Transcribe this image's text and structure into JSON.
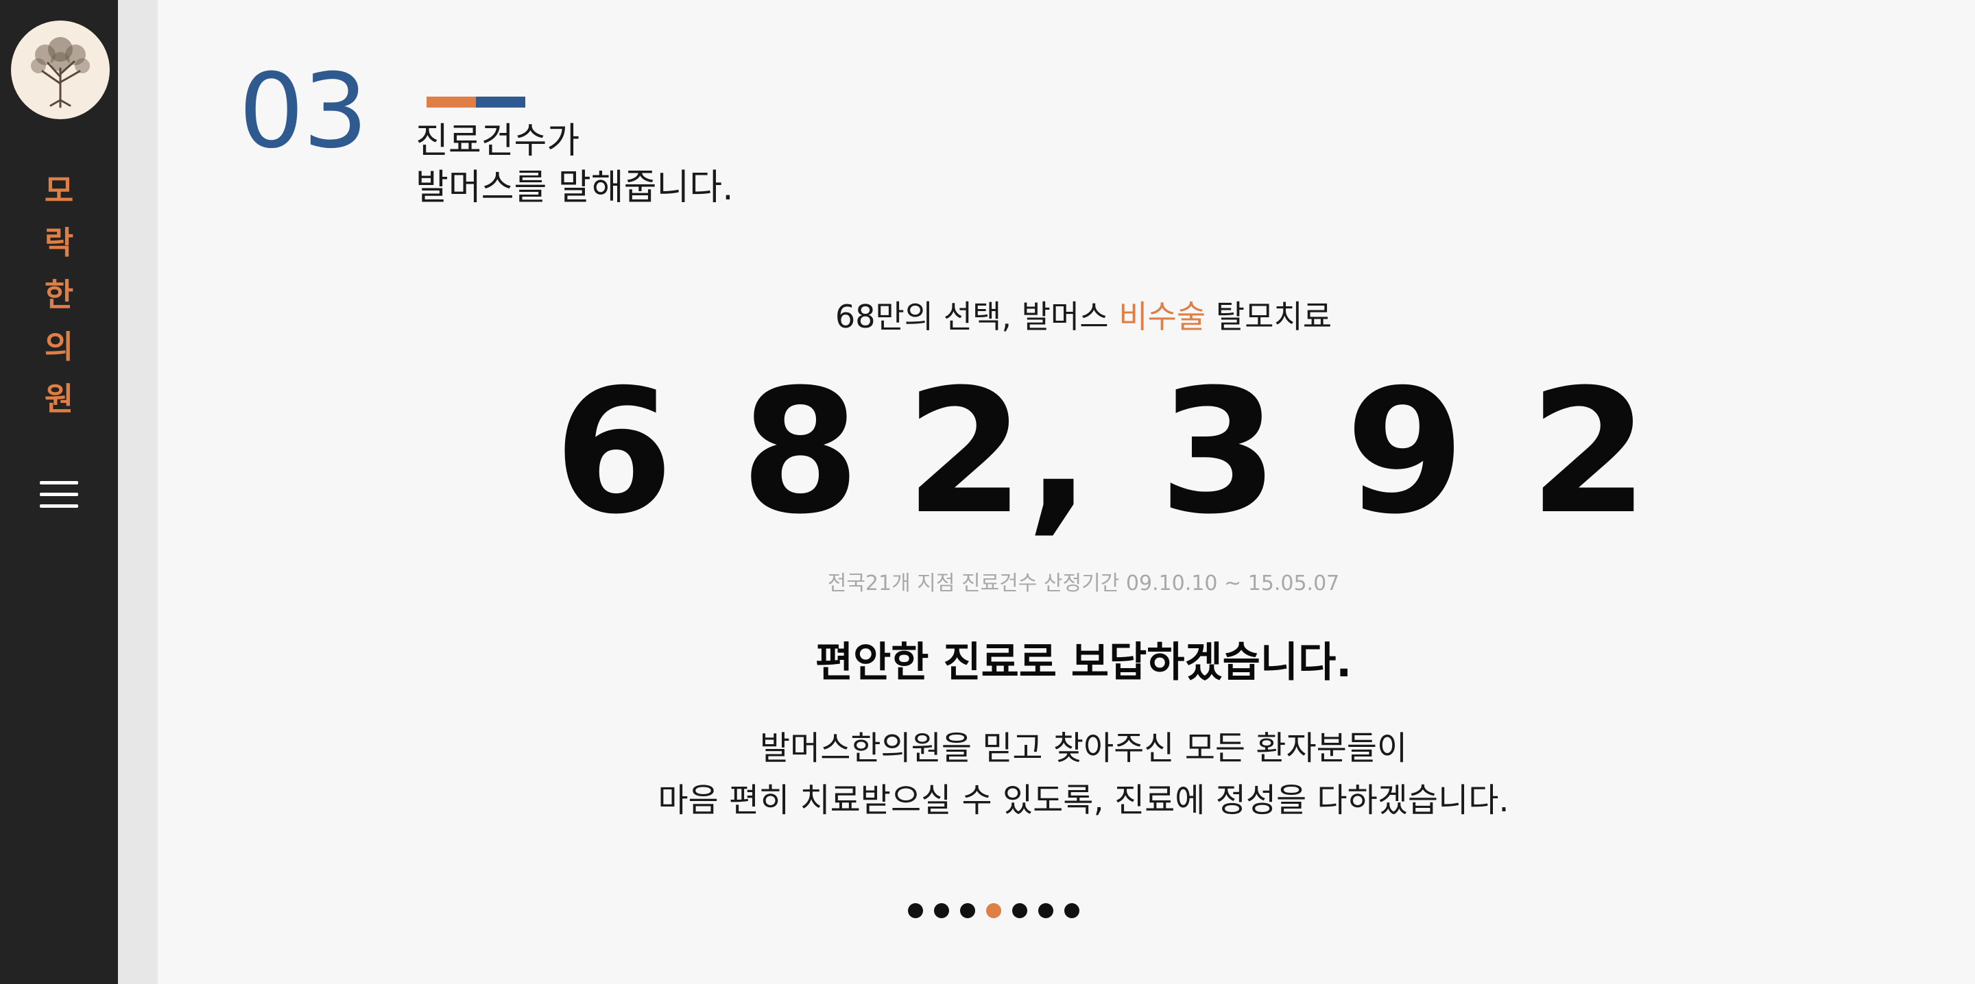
{
  "sidebar": {
    "brand_chars": [
      "모",
      "락",
      "한",
      "의",
      "원"
    ],
    "logo_icon": "tree-icon",
    "menu_icon": "hamburger-menu-icon"
  },
  "section": {
    "number": "03",
    "title_line1": "진료건수가",
    "title_line2": "발머스를 말해줍니다."
  },
  "main": {
    "tagline_before": "68만의 선택, 발머스 ",
    "tagline_accent": "비수술",
    "tagline_after": " 탈모치료",
    "counter_digits": [
      "6",
      "8",
      "2",
      ",",
      "3",
      "9",
      "2"
    ],
    "note": "전국21개 지점 진료건수 산정기간 09.10.10 ~ 15.05.07",
    "heading": "편안한 진료로 보답하겠습니다.",
    "body_line1": "발머스한의원을 믿고 찾아주신 모든 환자분들이",
    "body_line2": "마음 편히 치료받으실 수 있도록, 진료에 정성을 다하겠습니다."
  },
  "pagination": {
    "count": 7,
    "active_index": 3
  },
  "colors": {
    "accent_orange": "#e07f45",
    "accent_blue": "#2f5a8f",
    "sidebar_bg": "#232323",
    "page_bg": "#f7f7f7"
  }
}
